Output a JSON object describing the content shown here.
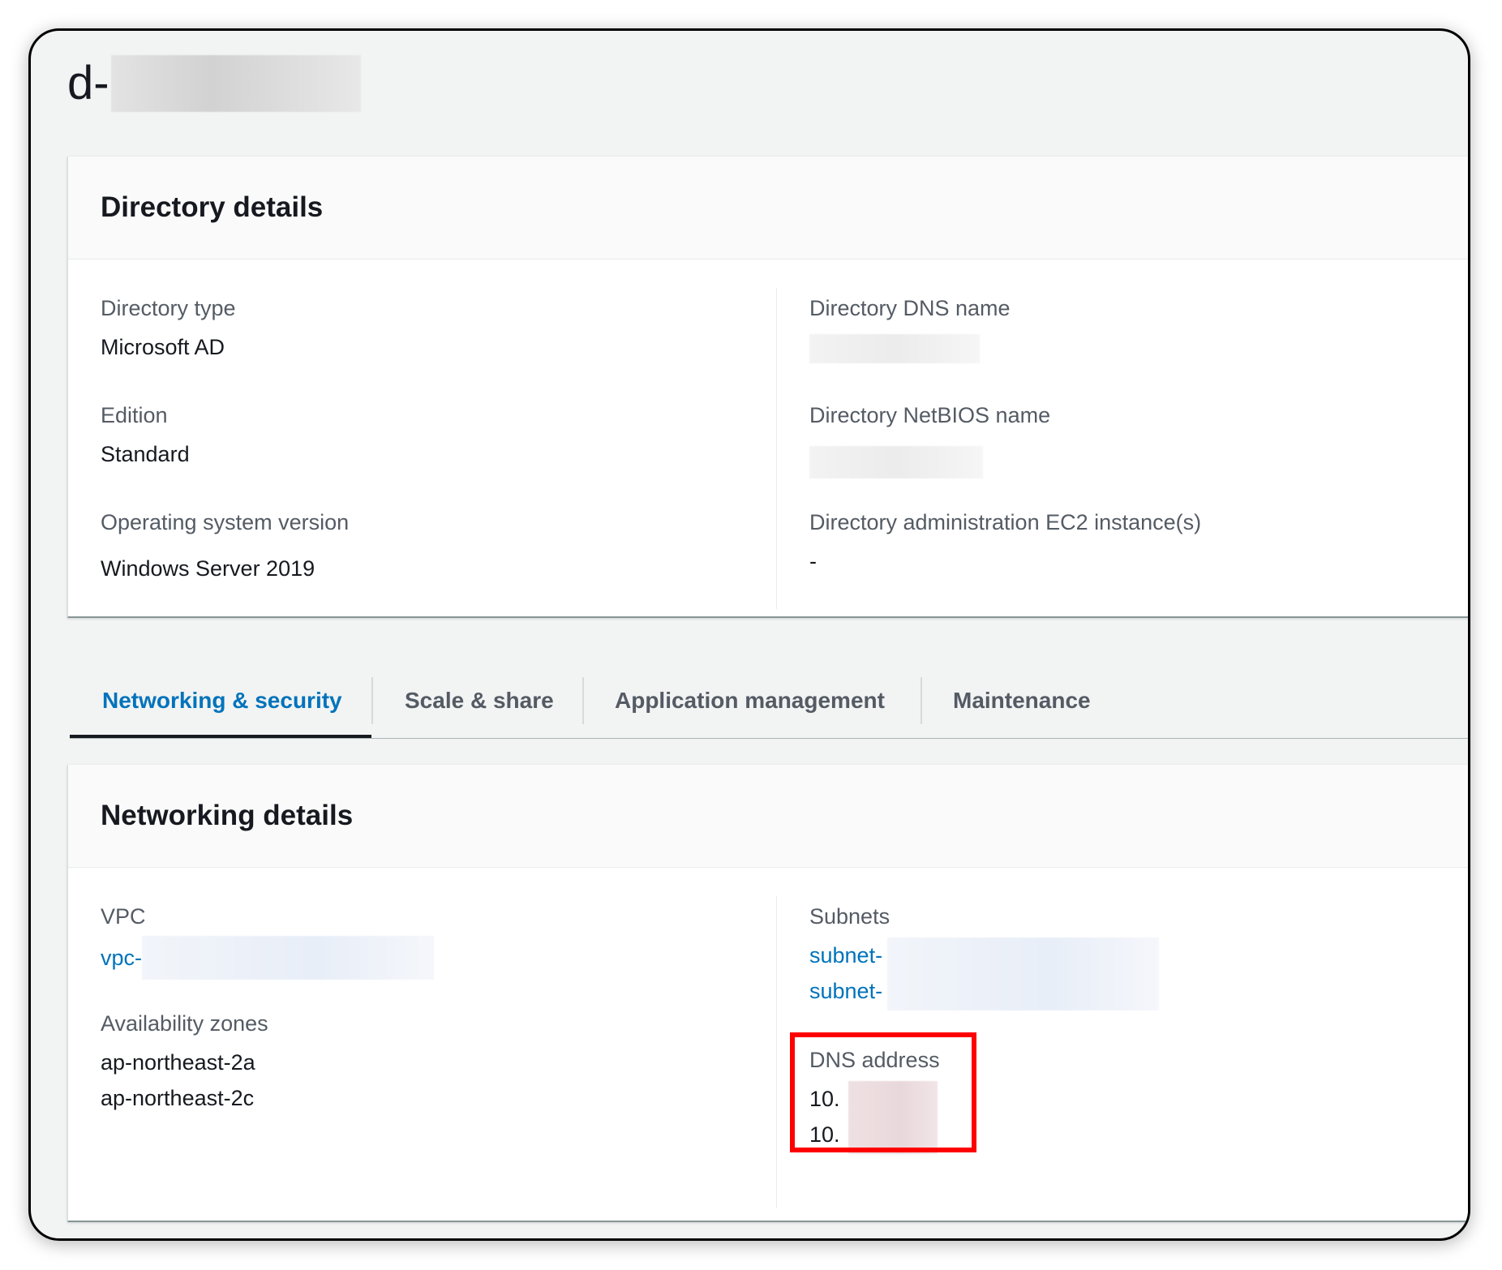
{
  "page": {
    "title_prefix": "d-"
  },
  "directory_details": {
    "heading": "Directory details",
    "left": {
      "directory_type_label": "Directory type",
      "directory_type_value": "Microsoft AD",
      "edition_label": "Edition",
      "edition_value": "Standard",
      "os_version_label": "Operating system version",
      "os_version_value": "Windows Server 2019"
    },
    "right": {
      "dns_name_label": "Directory DNS name",
      "netbios_label": "Directory NetBIOS name",
      "admin_instances_label": "Directory administration EC2 instance(s)",
      "admin_instances_value": "-"
    }
  },
  "tabs": [
    {
      "label": "Networking & security",
      "active": true
    },
    {
      "label": "Scale & share",
      "active": false
    },
    {
      "label": "Application management",
      "active": false
    },
    {
      "label": "Maintenance",
      "active": false
    }
  ],
  "networking_details": {
    "heading": "Networking details",
    "vpc_label": "VPC",
    "vpc_link_prefix": "vpc-",
    "az_label": "Availability zones",
    "az_values": [
      "ap-northeast-2a",
      "ap-northeast-2c"
    ],
    "subnets_label": "Subnets",
    "subnet_link_prefixes": [
      "subnet-",
      "subnet-"
    ],
    "dns_address_label": "DNS address",
    "dns_address_prefixes": [
      "10.",
      "10."
    ]
  },
  "colors": {
    "link": "#0073bb",
    "highlight": "#ff0000",
    "text": "#16191f",
    "label": "#545b64"
  }
}
